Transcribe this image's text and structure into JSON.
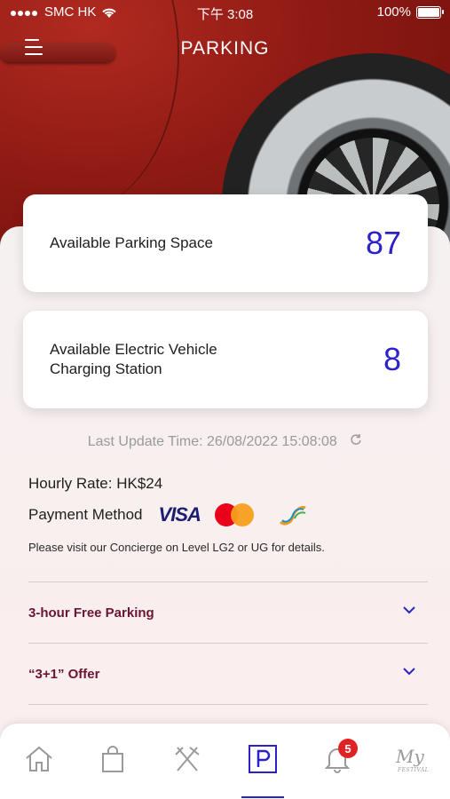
{
  "status_bar": {
    "carrier": "SMC HK",
    "time": "下午 3:08",
    "battery": "100%"
  },
  "header": {
    "title": "PARKING",
    "menu_icon": "hamburger-menu-icon"
  },
  "availability": {
    "parking": {
      "label": "Available Parking Space",
      "value": "87"
    },
    "ev": {
      "label": "Available Electric Vehicle Charging Station",
      "value": "8"
    }
  },
  "last_update": "Last Update Time: 26/08/2022 15:08:08",
  "rate": "Hourly Rate: HK$24",
  "payment": {
    "label": "Payment Method",
    "methods": [
      "VISA",
      "mastercard-logo",
      "octopus-logo"
    ]
  },
  "visa_text": "VISA",
  "note": "Please visit our Concierge on Level LG2 or UG for details.",
  "offers": [
    {
      "title": "3-hour Free Parking"
    },
    {
      "title": "“3+1” Offer"
    }
  ],
  "tabbar": {
    "items": [
      "home-icon",
      "shopping-bag-icon",
      "dining-icon",
      "parking-icon",
      "bell-icon",
      "my-festival-logo"
    ],
    "active": "parking-icon",
    "notification_count": "5",
    "festival_logo_text": "My",
    "festival_logo_sub": "FESTIVAL"
  },
  "colors": {
    "accent": "#2b23c9",
    "offer_title": "#6a1535",
    "badge": "#e02222"
  }
}
